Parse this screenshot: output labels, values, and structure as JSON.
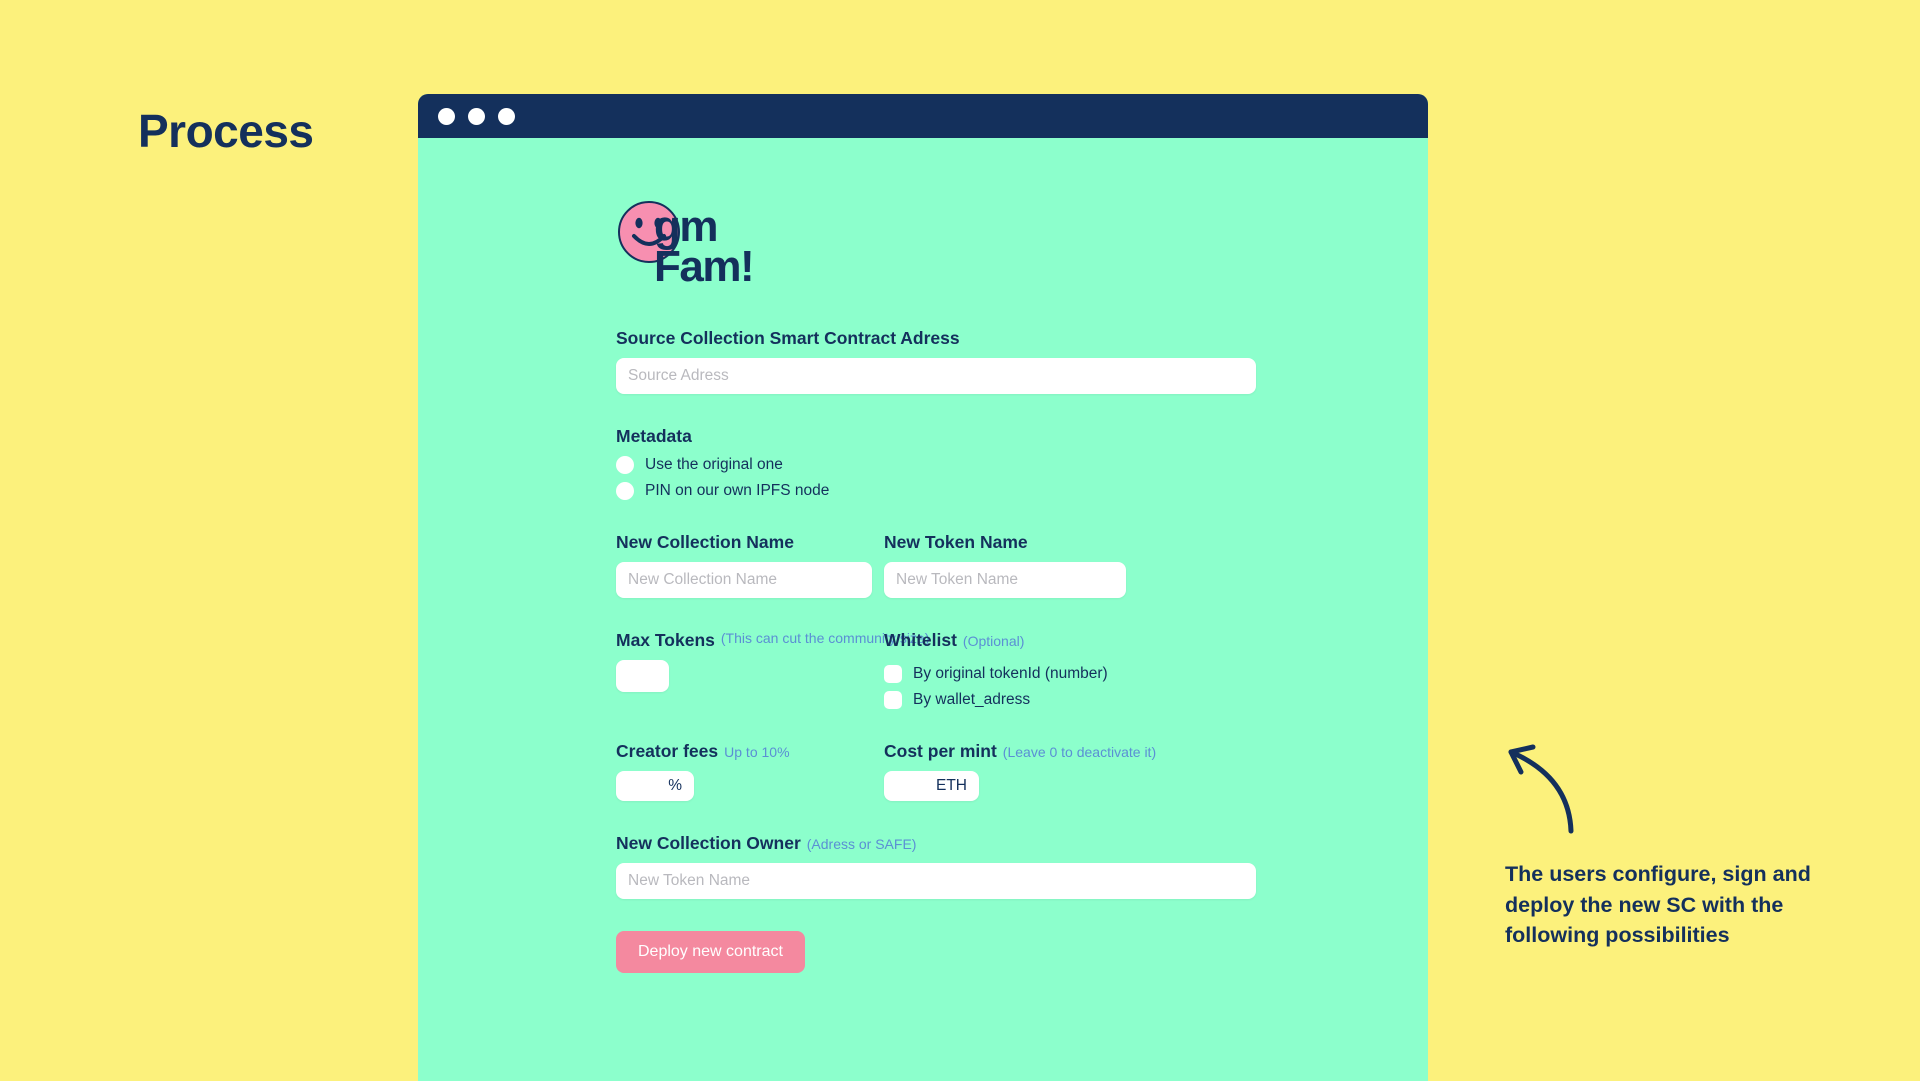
{
  "slide": {
    "title": "Process",
    "annotation": "The users configure, sign and deploy the new SC with the following possibilities",
    "arrow_icon": "curved-arrow-up-left-icon",
    "yellow_bg": "#FCF17C",
    "navy": "#14305C"
  },
  "window": {
    "titlebar_color": "#14305C",
    "dots": [
      "window-dot-close",
      "window-dot-minimize",
      "window-dot-maximize"
    ],
    "page_bg": "#8CFFCC"
  },
  "app": {
    "logo_line1": "gm",
    "logo_line2": "Fam!",
    "logo_icon": "smiley-face-icon",
    "logo_face_color": "#F78FB0"
  },
  "form": {
    "source_contract": {
      "label": "Source Collection Smart Contract Adress",
      "placeholder": "Source Adress",
      "value": ""
    },
    "metadata": {
      "label": "Metadata",
      "options": [
        {
          "label": "Use the original one",
          "checked": false
        },
        {
          "label": "PIN on our own IPFS node",
          "checked": false
        }
      ]
    },
    "new_collection_name": {
      "label": "New Collection Name",
      "placeholder": "New Collection Name",
      "value": ""
    },
    "new_token_name": {
      "label": "New Token Name",
      "placeholder": "New Token Name",
      "value": ""
    },
    "max_tokens": {
      "label": "Max Tokens",
      "hint": "(This can cut the community size)",
      "value": ""
    },
    "whitelist": {
      "label": "Whitelist",
      "hint": "(Optional)",
      "options": [
        {
          "label": "By original tokenId (number)",
          "checked": false
        },
        {
          "label": "By wallet_adress",
          "checked": false
        }
      ]
    },
    "creator_fees": {
      "label": "Creator fees",
      "hint": "Up to 10%",
      "unit": "%",
      "value": ""
    },
    "cost_per_mint": {
      "label": "Cost per mint",
      "hint": "(Leave 0 to deactivate it)",
      "unit": "ETH",
      "value": ""
    },
    "new_collection_owner": {
      "label": "New Collection Owner",
      "hint": "(Adress or SAFE)",
      "placeholder": "New Token Name",
      "value": ""
    },
    "deploy_button": "Deploy new contract",
    "deploy_button_color": "#F4899F"
  }
}
